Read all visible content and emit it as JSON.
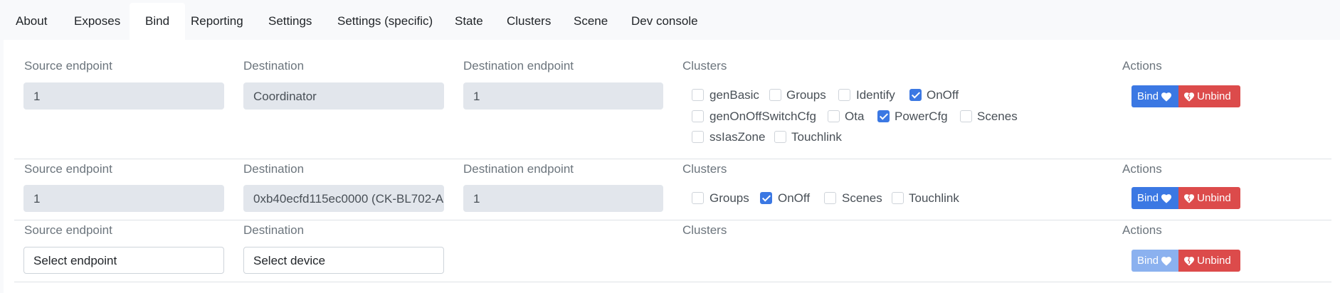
{
  "tabs": [
    {
      "label": "About",
      "active": false
    },
    {
      "label": "Exposes",
      "active": false
    },
    {
      "label": "Bind",
      "active": true
    },
    {
      "label": "Reporting",
      "active": false
    },
    {
      "label": "Settings",
      "active": false
    },
    {
      "label": "Settings (specific)",
      "active": false
    },
    {
      "label": "State",
      "active": false
    },
    {
      "label": "Clusters",
      "active": false
    },
    {
      "label": "Scene",
      "active": false
    },
    {
      "label": "Dev console",
      "active": false
    }
  ],
  "labels": {
    "source_endpoint": "Source endpoint",
    "destination": "Destination",
    "destination_endpoint": "Destination endpoint",
    "clusters": "Clusters",
    "actions": "Actions"
  },
  "buttons": {
    "bind": "Bind",
    "unbind": "Unbind"
  },
  "colors": {
    "primary": "#3b78e3",
    "danger": "#dc4b4b",
    "disabled_primary": "#8bb1ef"
  },
  "rows": [
    {
      "source_endpoint": "1",
      "destination": "Coordinator",
      "destination_endpoint": "1",
      "clusters": [
        {
          "name": "genBasic",
          "checked": false
        },
        {
          "name": "Groups",
          "checked": false
        },
        {
          "name": "Identify",
          "checked": false
        },
        {
          "name": "OnOff",
          "checked": true
        },
        {
          "name": "genOnOffSwitchCfg",
          "checked": false
        },
        {
          "name": "Ota",
          "checked": false
        },
        {
          "name": "PowerCfg",
          "checked": true
        },
        {
          "name": "Scenes",
          "checked": false
        },
        {
          "name": "ssIasZone",
          "checked": false
        },
        {
          "name": "Touchlink",
          "checked": false
        }
      ]
    },
    {
      "source_endpoint": "1",
      "destination": "0xb40ecfd115ec0000 (CK-BL702-A",
      "destination_endpoint": "1",
      "clusters": [
        {
          "name": "Groups",
          "checked": false
        },
        {
          "name": "OnOff",
          "checked": true
        },
        {
          "name": "Scenes",
          "checked": false
        },
        {
          "name": "Touchlink",
          "checked": false
        }
      ]
    },
    {
      "source_endpoint_placeholder": "Select endpoint",
      "destination_placeholder": "Select device",
      "bind_disabled": true
    }
  ]
}
